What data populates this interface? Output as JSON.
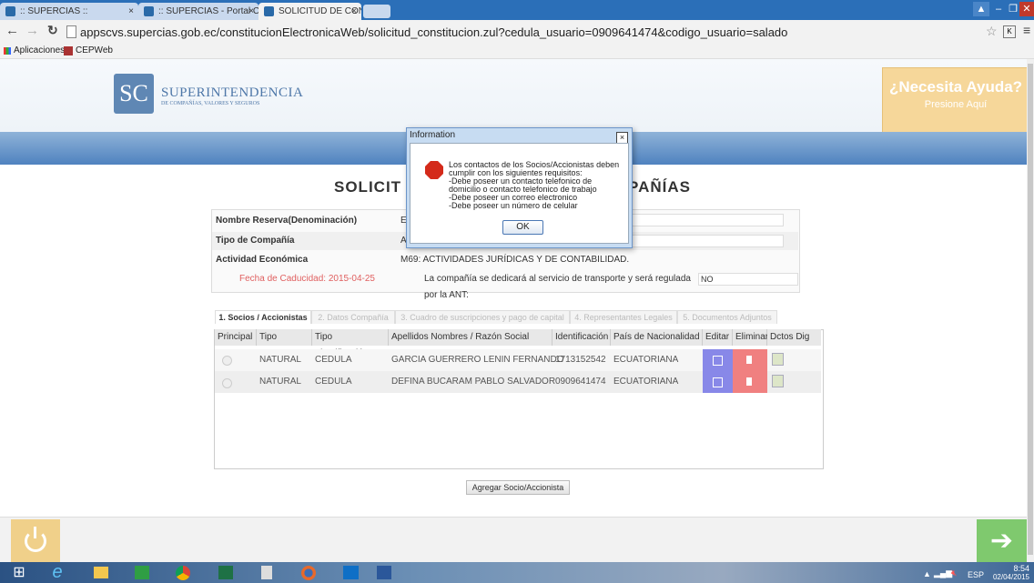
{
  "browser": {
    "tabs": [
      {
        "label": ":: SUPERCIAS ::",
        "active": false
      },
      {
        "label": ":: SUPERCIAS - Portal Corp",
        "active": false
      },
      {
        "label": "SOLICITUD DE CONSTITU",
        "active": true
      }
    ],
    "address": "appscvs.supercias.gob.ec/constitucionElectronicaWeb/solicitud_constitucion.zul?cedula_usuario=0909641474&codigo_usuario=salado",
    "bookmarks": [
      "Aplicaciones",
      "CEPWeb"
    ],
    "window_controls": [
      "user-icon",
      "minimize-icon",
      "restore-icon",
      "close-icon"
    ]
  },
  "header": {
    "logo_initials": "SC",
    "logo_title": "SUPERINTENDENCIA",
    "logo_subtitle": "DE COMPAÑÍAS, VALORES Y SEGUROS",
    "help_title": "¿Necesita Ayuda?",
    "help_sub": "Presione Aquí"
  },
  "page": {
    "title_left": "SOLICIT",
    "title_right": "PAÑÍAS",
    "form": {
      "nombre_label": "Nombre Reserva(Denominación)",
      "nombre_value": "E",
      "tipo_label": "Tipo de Compañía",
      "tipo_value": "A",
      "actividad_label": "Actividad Económica",
      "actividad_value": "M69: ACTIVIDADES JURÍDICAS Y DE CONTABILIDAD.",
      "fecha_label": "Fecha de Caducidad: 2015-04-25",
      "transporte_label": "La compañía se dedicará al servicio de transporte y será regulada por la ANT:",
      "transporte_value": "NO"
    },
    "tabs": [
      "1. Socios / Accionistas",
      "2. Datos Compañía",
      "3. Cuadro de suscripciones y pago de capital",
      "4. Representantes Legales",
      "5. Documentos Adjuntos"
    ],
    "grid_headers": [
      "Principal",
      "Tipo",
      "Tipo Identificación",
      "Apellidos Nombres / Razón Social",
      "Identificación",
      "País de Nacionalidad",
      "Editar",
      "Eliminar",
      "Dctos Dig"
    ],
    "rows": [
      {
        "tipo": "NATURAL",
        "tipo_id": "CEDULA",
        "nombre": "GARCIA GUERRERO LENIN FERNANDO",
        "identificacion": "1713152542",
        "pais": "ECUATORIANA"
      },
      {
        "tipo": "NATURAL",
        "tipo_id": "CEDULA",
        "nombre": "DEFINA BUCARAM PABLO SALVADOR",
        "identificacion": "0909641474",
        "pais": "ECUATORIANA"
      }
    ],
    "add_button": "Agregar Socio/Accionista"
  },
  "modal": {
    "title": "Information",
    "message": "Los contactos de los Socios/Accionistas deben\ncumplir con los siguientes requisitos:\n-Debe poseer un contacto telefonico de\ndomicilio o contacto telefonico de trabajo\n-Debe poseer un correo electronico\n-Debe poseer un número de celular",
    "ok_label": "OK",
    "close_label": "×"
  },
  "taskbar": {
    "lang": "ESP",
    "time": "8:54",
    "date": "02/04/2015",
    "apps": [
      "windows-start-icon",
      "internet-explorer-icon",
      "file-explorer-icon",
      "store-icon",
      "chrome-icon",
      "excel-icon",
      "calculator-icon",
      "firefox-icon",
      "outlook-icon",
      "word-icon"
    ]
  },
  "colors": {
    "tabstrip": "#2b6fb8",
    "band": "#6a98cc",
    "help_box": "#f6d79a",
    "edit_btn": "#8888e8",
    "delete_btn": "#f08080",
    "power_btn": "#f0d08a",
    "next_btn": "#7fc96e"
  }
}
